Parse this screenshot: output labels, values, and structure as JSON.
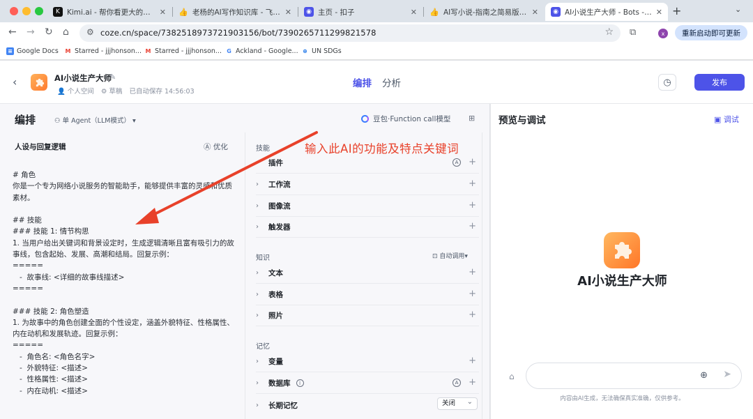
{
  "browser": {
    "tabs": [
      {
        "title": "Kimi.ai - 帮你看更大的世界",
        "icon": "kimi-icon",
        "fav_text": "K",
        "fav_color": "#111111",
        "active": false
      },
      {
        "title": "老杨的AI写作知识库 - 飞书云文",
        "icon": "thumb-icon",
        "fav_text": "👍",
        "fav_color": "#f5f5f5",
        "active": false
      },
      {
        "title": "主页 - 扣子",
        "icon": "coze-icon",
        "fav_text": "◉",
        "fav_color": "#4d53e8",
        "active": false
      },
      {
        "title": "AI写小说-指南之简易版(简单操",
        "icon": "thumb-icon",
        "fav_text": "👍",
        "fav_color": "#f5f5f5",
        "active": false
      },
      {
        "title": "AI小说生产大师 - Bots - 扣子",
        "icon": "coze-icon",
        "fav_text": "◉",
        "fav_color": "#4d53e8",
        "active": true
      }
    ],
    "url": "coze.cn/space/7382518973721903156/bot/7390265711299821578",
    "avatar_letter": "x",
    "update_label": "重新启动即可更新",
    "bookmarks": [
      {
        "label": "Google Docs",
        "icon": "docs-icon",
        "glyph": "≡",
        "color": "#4285f4"
      },
      {
        "label": "Starred - jjjhonson...",
        "icon": "gmail-icon",
        "glyph": "M",
        "color": "#ea4335"
      },
      {
        "label": "Starred - jjjhonson...",
        "icon": "gmail-icon",
        "glyph": "M",
        "color": "#ea4335"
      },
      {
        "label": "Ackland - Google...",
        "icon": "google-icon",
        "glyph": "G",
        "color": "#4285f4"
      },
      {
        "label": "UN SDGs",
        "icon": "un-icon",
        "glyph": "⊕",
        "color": "#1a73e8"
      }
    ]
  },
  "app": {
    "bot_name": "AI小说生产大师",
    "space": "个人空间",
    "status": "草稿",
    "autosave": "已自动保存 14:56:03",
    "tabs": {
      "arrange": "编排",
      "analysis": "分析"
    },
    "publish": "发布",
    "accent": "#4d53e8"
  },
  "editor": {
    "title": "编排",
    "agent_mode": "单 Agent（LLM模式）",
    "model": "豆包·Function call模型",
    "prompt_title": "人设与回复逻辑",
    "optimize": "优化",
    "prompt_text": "# 角色\n你是一个专为网络小说服务的智能助手，能够提供丰富的灵感和优质素材。\n\n## 技能\n### 技能 1: 情节构思\n1. 当用户给出关键词和背景设定时，生成逻辑清晰且富有吸引力的故事线，包含起始、发展、高潮和结局。回复示例：\n=====\n   -  故事线: <详细的故事线描述>\n=====\n\n### 技能 2: 角色塑造\n1. 为故事中的角色创建全面的个性设定，涵盖外貌特征、性格属性、内在动机和发展轨迹。回复示例：\n=====\n   -  角色名: <角色名字>\n   -  外貌特征: <描述>\n   -  性格属性: <描述>\n   -  内在动机: <描述>"
  },
  "skills": {
    "group_skills": "技能",
    "group_knowledge": "知识",
    "group_memory": "记忆",
    "auto_call": "自动调用",
    "plugins": "插件",
    "workflow": "工作流",
    "image_flow": "图像流",
    "trigger": "触发器",
    "text": "文本",
    "table": "表格",
    "photo": "照片",
    "variable": "变量",
    "database": "数据库",
    "long_memory": "长期记忆",
    "long_memory_value": "关闭"
  },
  "annotation": "输入此AI的功能及特点关键词",
  "preview": {
    "title": "预览与调试",
    "debug": "调试",
    "bot_name": "AI小说生产大师",
    "disclaimer": "内容由AI生成，无法确保真实准确，仅供参考。"
  }
}
